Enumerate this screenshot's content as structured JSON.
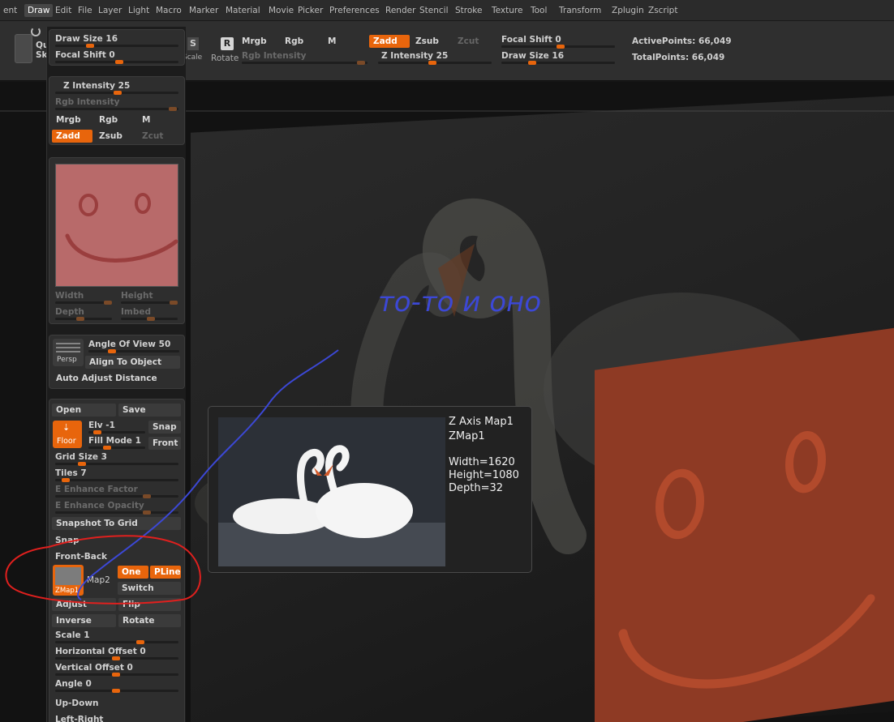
{
  "menubar": {
    "items": [
      "ent",
      "Draw",
      "Edit",
      "File",
      "Layer",
      "Light",
      "Macro",
      "Marker",
      "Material",
      "Movie",
      "Picker",
      "Preferences",
      "Render",
      "Stencil",
      "Stroke",
      "Texture",
      "Tool",
      "Transform",
      "Zplugin",
      "Zscript"
    ],
    "active_index": 1
  },
  "shelf": {
    "quick_left": "Qu",
    "quick_left2": "Sk",
    "scale_label": "Scale",
    "rotate_label": "Rotate",
    "mrgb": "Mrgb",
    "rgb": "Rgb",
    "m": "M",
    "zadd": "Zadd",
    "zsub": "Zsub",
    "zcut": "Zcut",
    "rgb_intensity": "Rgb Intensity",
    "z_intensity": "Z Intensity 25",
    "focal_shift": "Focal Shift 0",
    "draw_size": "Draw Size 16",
    "active_points": "ActivePoints: 66,049",
    "total_points": "TotalPoints: 66,049",
    "accent": "#e8650c"
  },
  "palette": {
    "draw_size": "Draw Size 16",
    "focal_shift": "Focal Shift 0",
    "z_intensity": "Z Intensity 25",
    "rgb_intensity": "Rgb Intensity",
    "mrgb": "Mrgb",
    "rgb": "Rgb",
    "m": "M",
    "zadd": "Zadd",
    "zsub": "Zsub",
    "zcut": "Zcut",
    "width": "Width",
    "height": "Height",
    "depth": "Depth",
    "imbed": "Imbed",
    "persp": "Persp",
    "angle_of_view": "Angle Of View 50",
    "align_to_object": "Align To Object",
    "auto_adjust": "Auto Adjust Distance",
    "open": "Open",
    "save": "Save",
    "floor": "Floor",
    "elv": "Elv -1",
    "snap": "Snap",
    "fill_mode": "Fill Mode 1",
    "front": "Front",
    "grid_size": "Grid Size 3",
    "tiles": "Tiles 7",
    "e_enhance_factor": "E Enhance Factor",
    "e_enhance_opacity": "E Enhance Opacity",
    "snapshot_to_grid": "Snapshot To Grid",
    "snap2": "Snap",
    "front_back": "Front-Back",
    "zmap1": "ZMap1",
    "map2": "Map2",
    "one": "One",
    "pline": "PLine",
    "switch": "Switch",
    "adjust": "Adjust",
    "flip": "Flip",
    "inverse": "Inverse",
    "rotate": "Rotate",
    "scale": "Scale 1",
    "horizontal_offset": "Horizontal Offset 0",
    "vertical_offset": "Vertical Offset 0",
    "angle": "Angle 0",
    "up_down": "Up-Down",
    "left_right": "Left-Right"
  },
  "popup": {
    "title": "Z Axis Map1",
    "name": "ZMap1",
    "width": "Width=1620",
    "height": "Height=1080",
    "depth": "Depth=32"
  },
  "annotation": {
    "text": "то-то и оно",
    "color": "#3c48d6",
    "circle_color": "#e0201e"
  }
}
